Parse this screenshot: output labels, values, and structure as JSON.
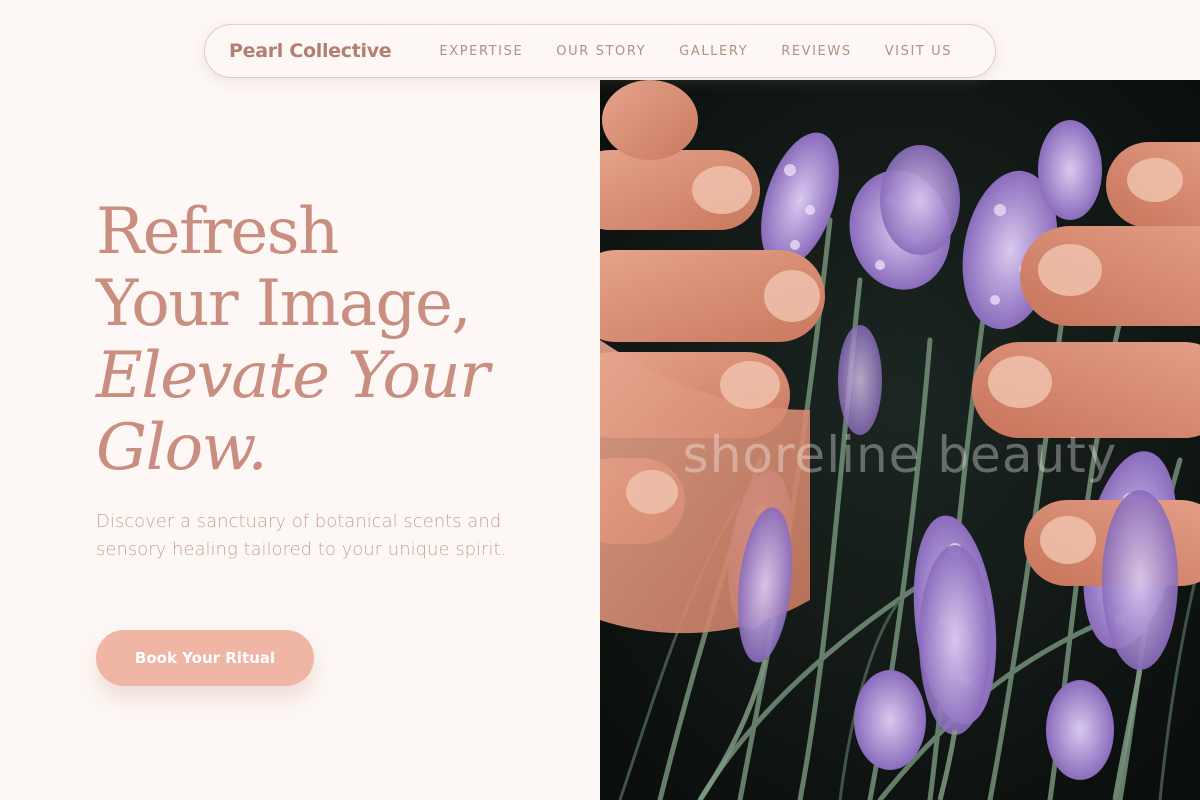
{
  "nav": {
    "brand": "Pearl Collective",
    "links": [
      {
        "label": "EXPERTISE"
      },
      {
        "label": "OUR STORY"
      },
      {
        "label": "GALLERY"
      },
      {
        "label": "REVIEWS"
      },
      {
        "label": "VISIT US"
      }
    ]
  },
  "hero": {
    "headline_lines": [
      "Refresh",
      "Your Image,",
      "Elevate Your",
      "Glow."
    ],
    "subtext": "Discover a sanctuary of botanical scents and sensory healing tailored to your unique spirit.",
    "cta_label": "Book Your Ritual"
  },
  "image": {
    "watermark": "shoreline beauty"
  },
  "colors": {
    "background": "#fdf8f5",
    "brand_text": "#b47f73",
    "headline": "#c98e80",
    "body_text": "#caa297",
    "cta_background": "#efb5a5",
    "lavender": "#9a7fc8"
  }
}
